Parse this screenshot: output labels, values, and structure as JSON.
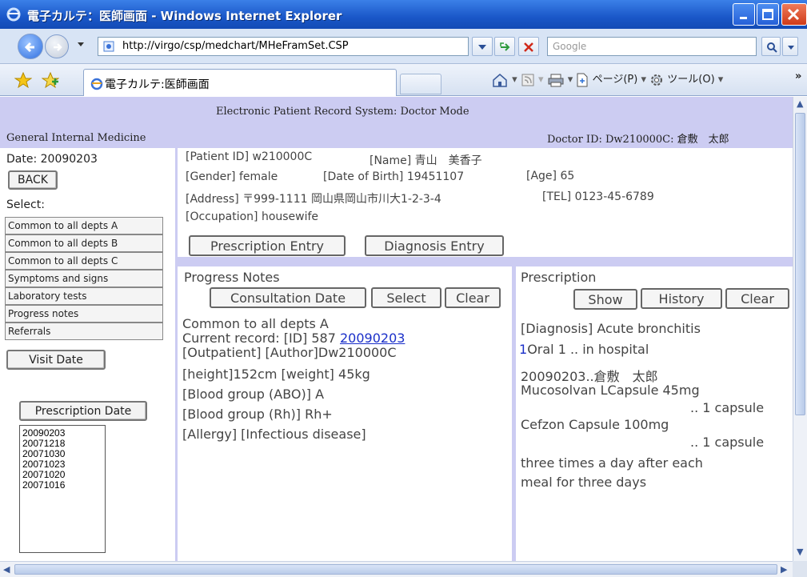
{
  "window": {
    "title": "電子カルテ：医師画面 - Windows Internet Explorer"
  },
  "browser": {
    "url": "http://virgo/csp/medchart/MHeFramSet.CSP",
    "search_placeholder": "Google",
    "tab_label": "電子カルテ:医師画面",
    "cmd_page": "ページ(P)",
    "cmd_tools": "ツール(O)",
    "cmd_more": "»"
  },
  "header": {
    "system_title": "Electronic Patient Record System:  Doctor Mode",
    "department": "General Internal Medicine",
    "doctor": "Doctor ID: Dw210000C: 倉敷　太郎"
  },
  "left": {
    "date_label": "Date: 20090203",
    "back_button": "BACK",
    "select_label": "Select:",
    "dept_items": [
      "Common to all depts A",
      "Common to all depts B",
      "Common to all depts C",
      "Symptoms and signs",
      "Laboratory tests",
      "Progress notes",
      "Referrals"
    ],
    "visit_date_button": "Visit Date",
    "prescription_date_button": "Prescription Date",
    "dates": [
      "20090203",
      "20071218",
      "20071030",
      "20071023",
      "20071020",
      "20071016"
    ]
  },
  "patient": {
    "id": "[Patient ID] w210000C",
    "name": "[Name] 青山　美香子",
    "gender": "[Gender] female",
    "dob": "[Date of Birth] 19451107",
    "age": "[Age]  65",
    "address": "[Address]  〒999-1111 岡山県岡山市川大1-2-3-4",
    "tel": "[TEL] 0123-45-6789",
    "occupation": "[Occupation] housewife",
    "prescription_entry": "Prescription Entry",
    "diagnosis_entry": "Diagnosis Entry"
  },
  "notes": {
    "title": "Progress Notes",
    "consultation_date_button": "Consultation Date",
    "select_button": "Select",
    "clear_button": "Clear",
    "line1": "Common to all depts A",
    "line2_prefix": "Current record:  [ID] 587 ",
    "line2_link": "20090203",
    "line3": "[Outpatient]  [Author]Dw210000C",
    "line4": "[height]152cm  [weight] 45kg",
    "line5": "[Blood group (ABO)] A",
    "line6": "[Blood group (Rh)] Rh+",
    "line7": "[Allergy]    [Infectious disease]"
  },
  "prescription": {
    "title": "Prescription",
    "show_button": "Show",
    "history_button": "History",
    "clear_button": "Clear",
    "diagnosis": "[Diagnosis] Acute bronchitis",
    "line1_num": "1",
    "line1": "Oral 1 .. in hospital",
    "line2": "20090203..倉敷　太郎",
    "drug1": "Mucosolvan LCapsule 45mg",
    "drug1_qty": ".. 1 capsule",
    "drug2": "Cefzon Capsule 100mg",
    "drug2_qty": ".. 1 capsule",
    "instr1": "three times a day after each",
    "instr2": "meal for three days"
  },
  "colors": {
    "frame_bg": "#ccccf2",
    "link": "#1a2fc9",
    "titlebar": "#1a57c8"
  }
}
